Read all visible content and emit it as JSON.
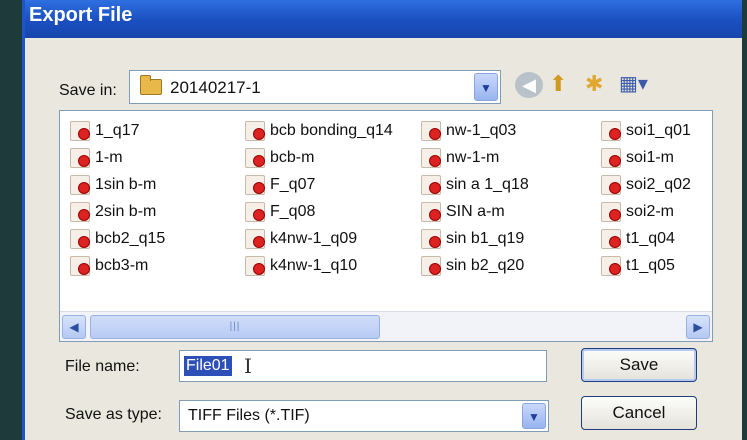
{
  "window": {
    "title": "Export File"
  },
  "save_in": {
    "label": "Save in:",
    "value": "20140217-1"
  },
  "toolbar": {
    "icons": [
      "back-icon",
      "up-folder-icon",
      "new-folder-icon",
      "views-menu-icon"
    ]
  },
  "files": {
    "columns": [
      [
        "1_q17",
        "1-m",
        "1sin b-m",
        "2sin b-m",
        "bcb2_q15",
        "bcb3-m"
      ],
      [
        "bcb bonding_q14",
        "bcb-m",
        "F_q07",
        "F_q08",
        "k4nw-1_q09",
        "k4nw-1_q10"
      ],
      [
        "nw-1_q03",
        "nw-1-m",
        "sin a 1_q18",
        "SIN a-m",
        "sin b1_q19",
        "sin b2_q20"
      ],
      [
        "soi1_q01",
        "soi1-m",
        "soi2_q02",
        "soi2-m",
        "t1_q04",
        "t1_q05"
      ]
    ]
  },
  "file_name": {
    "label": "File name:",
    "value": "File01"
  },
  "save_as_type": {
    "label": "Save as type:",
    "value": "TIFF Files  (*.TIF)"
  },
  "buttons": {
    "save": "Save",
    "cancel": "Cancel"
  },
  "colors": {
    "titlebar": "#1a4fc0",
    "dialog": "#e9e7de",
    "selection": "#2c4fb8"
  }
}
